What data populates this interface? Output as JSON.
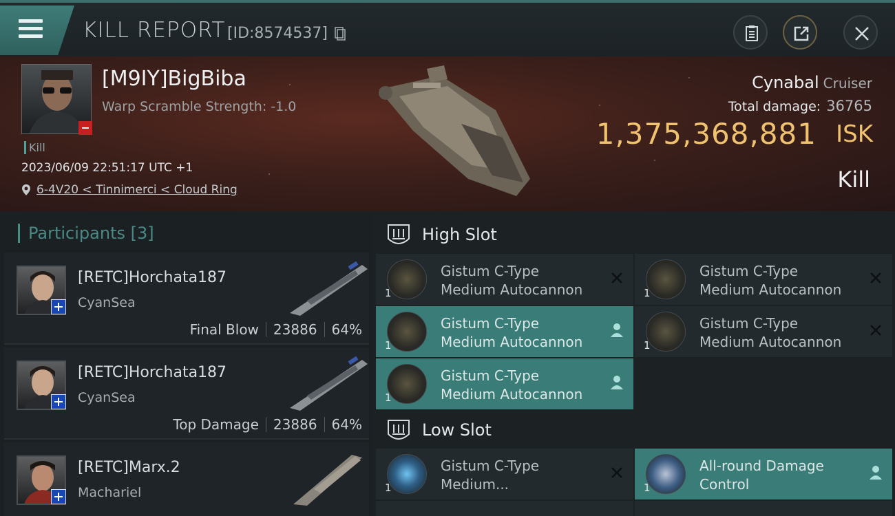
{
  "header": {
    "title": "KILL REPORT",
    "report_id": "[ID:8574537]",
    "icons": [
      "menu-icon",
      "copy-icon",
      "clipboard-icon",
      "share-icon",
      "close-icon"
    ]
  },
  "victim": {
    "pilot": "[M9IY]BigBiba",
    "warp_scramble": "Warp Scramble Strength: -1.0",
    "tag": "Kill",
    "datetime": "2023/06/09 22:51:17 UTC +1",
    "location": "6-4V20 < Tinnimerci < Cloud Ring",
    "ship_name": "Cynabal",
    "ship_class": "Cruiser",
    "total_damage_label": "Total damage:",
    "total_damage": "36765",
    "isk_value": "1,375,368,881",
    "isk_unit": "ISK",
    "result": "Kill"
  },
  "participants": {
    "header": "Participants [3]",
    "rows": [
      {
        "name": "[RETC]Horchata187",
        "ship": "CyanSea",
        "label": "Final Blow",
        "damage": "23886",
        "percent": "64%"
      },
      {
        "name": "[RETC]Horchata187",
        "ship": "CyanSea",
        "label": "Top Damage",
        "damage": "23886",
        "percent": "64%"
      },
      {
        "name": "[RETC]Marx.2",
        "ship": "Machariel",
        "label": "",
        "damage": "",
        "percent": ""
      }
    ]
  },
  "slots": {
    "high": {
      "label": "High Slot",
      "modules": [
        {
          "qty": "1",
          "line1": "Gistum C-Type",
          "line2": "Medium Autocannon",
          "state": "destroyed"
        },
        {
          "qty": "1",
          "line1": "Gistum C-Type",
          "line2": "Medium Autocannon",
          "state": "destroyed"
        },
        {
          "qty": "1",
          "line1": "Gistum C-Type",
          "line2": "Medium Autocannon",
          "state": "dropped"
        },
        {
          "qty": "1",
          "line1": "Gistum C-Type",
          "line2": "Medium Autocannon",
          "state": "destroyed"
        },
        {
          "qty": "1",
          "line1": "Gistum C-Type",
          "line2": "Medium Autocannon",
          "state": "dropped"
        }
      ]
    },
    "low": {
      "label": "Low Slot",
      "modules": [
        {
          "qty": "1",
          "line1": "Gistum C-Type",
          "line2": "Medium...",
          "state": "destroyed"
        },
        {
          "qty": "1",
          "line1": "All-round Damage",
          "line2": "Control",
          "state": "dropped"
        }
      ]
    }
  }
}
